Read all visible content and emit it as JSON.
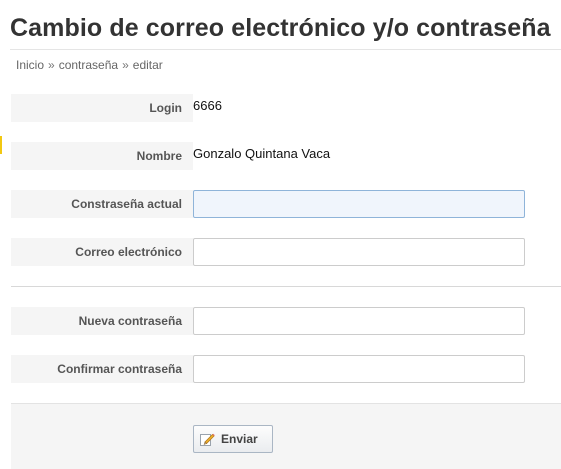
{
  "page": {
    "title": "Cambio de correo electrónico y/o contraseña"
  },
  "breadcrumb": {
    "items": [
      "Inicio",
      "contraseña",
      "editar"
    ],
    "separator": "»"
  },
  "form": {
    "login": {
      "label": "Login",
      "value": "6666"
    },
    "nombre": {
      "label": "Nombre",
      "value": "Gonzalo Quintana Vaca"
    },
    "current_password": {
      "label": "Constraseña actual",
      "value": ""
    },
    "email": {
      "label": "Correo electrónico",
      "value": ""
    },
    "new_password": {
      "label": "Nueva contraseña",
      "value": ""
    },
    "confirm_password": {
      "label": "Confirmar contraseña",
      "value": ""
    },
    "submit_label": "Enviar",
    "submit_icon": "pencil-edit-icon"
  },
  "colors": {
    "focus_border": "#8fb4d9",
    "label_background": "#f5f5f5",
    "edge_marker": "#f2c811"
  }
}
